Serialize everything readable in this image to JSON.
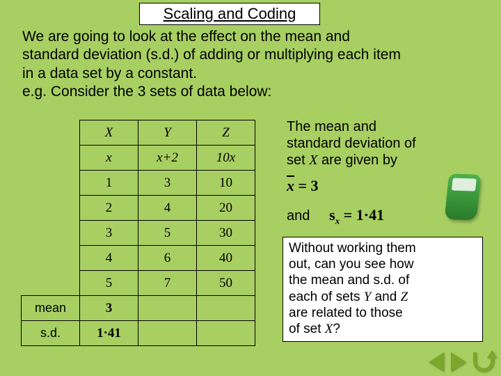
{
  "title": "Scaling and Coding",
  "intro_l1": "We are going to look at the effect on the mean and",
  "intro_l2": "standard deviation (s.d.) of adding or multiplying each item",
  "intro_l3": "in a data set by a constant.",
  "intro_l4": "e.g. Consider the 3 sets of data below:",
  "table": {
    "head": {
      "X": "X",
      "Y": "Y",
      "Z": "Z"
    },
    "expr": {
      "x": "x",
      "y": "x+2",
      "z": "10x"
    },
    "rows": [
      {
        "x": "1",
        "y": "3",
        "z": "10"
      },
      {
        "x": "2",
        "y": "4",
        "z": "20"
      },
      {
        "x": "3",
        "y": "5",
        "z": "30"
      },
      {
        "x": "4",
        "y": "6",
        "z": "40"
      },
      {
        "x": "5",
        "y": "7",
        "z": "50"
      }
    ],
    "meanlabel": "mean",
    "sdlabel": "s.d.",
    "meanX": "3",
    "sdX": "1·41"
  },
  "right_l1": "The mean and",
  "right_l2": "standard deviation of",
  "right_l3a": "set ",
  "right_l3b": "X",
  "right_l3c": " are given by",
  "formula_mean_lhs": "x",
  "formula_mean_eq": " = 3",
  "and": "and",
  "formula_sd_s": "s",
  "formula_sd_sub": "x",
  "formula_sd_eq": " = 1·41",
  "q_l1": "Without working them",
  "q_l2": "out, can you see how",
  "q_l3": "the mean and s.d. of",
  "q_l4a": "each of sets ",
  "q_l4y": "Y",
  "q_l4b": " and ",
  "q_l4z": "Z",
  "q_l5": "are related to those",
  "q_l6a": "of set ",
  "q_l6x": "X",
  "q_l6b": "?"
}
